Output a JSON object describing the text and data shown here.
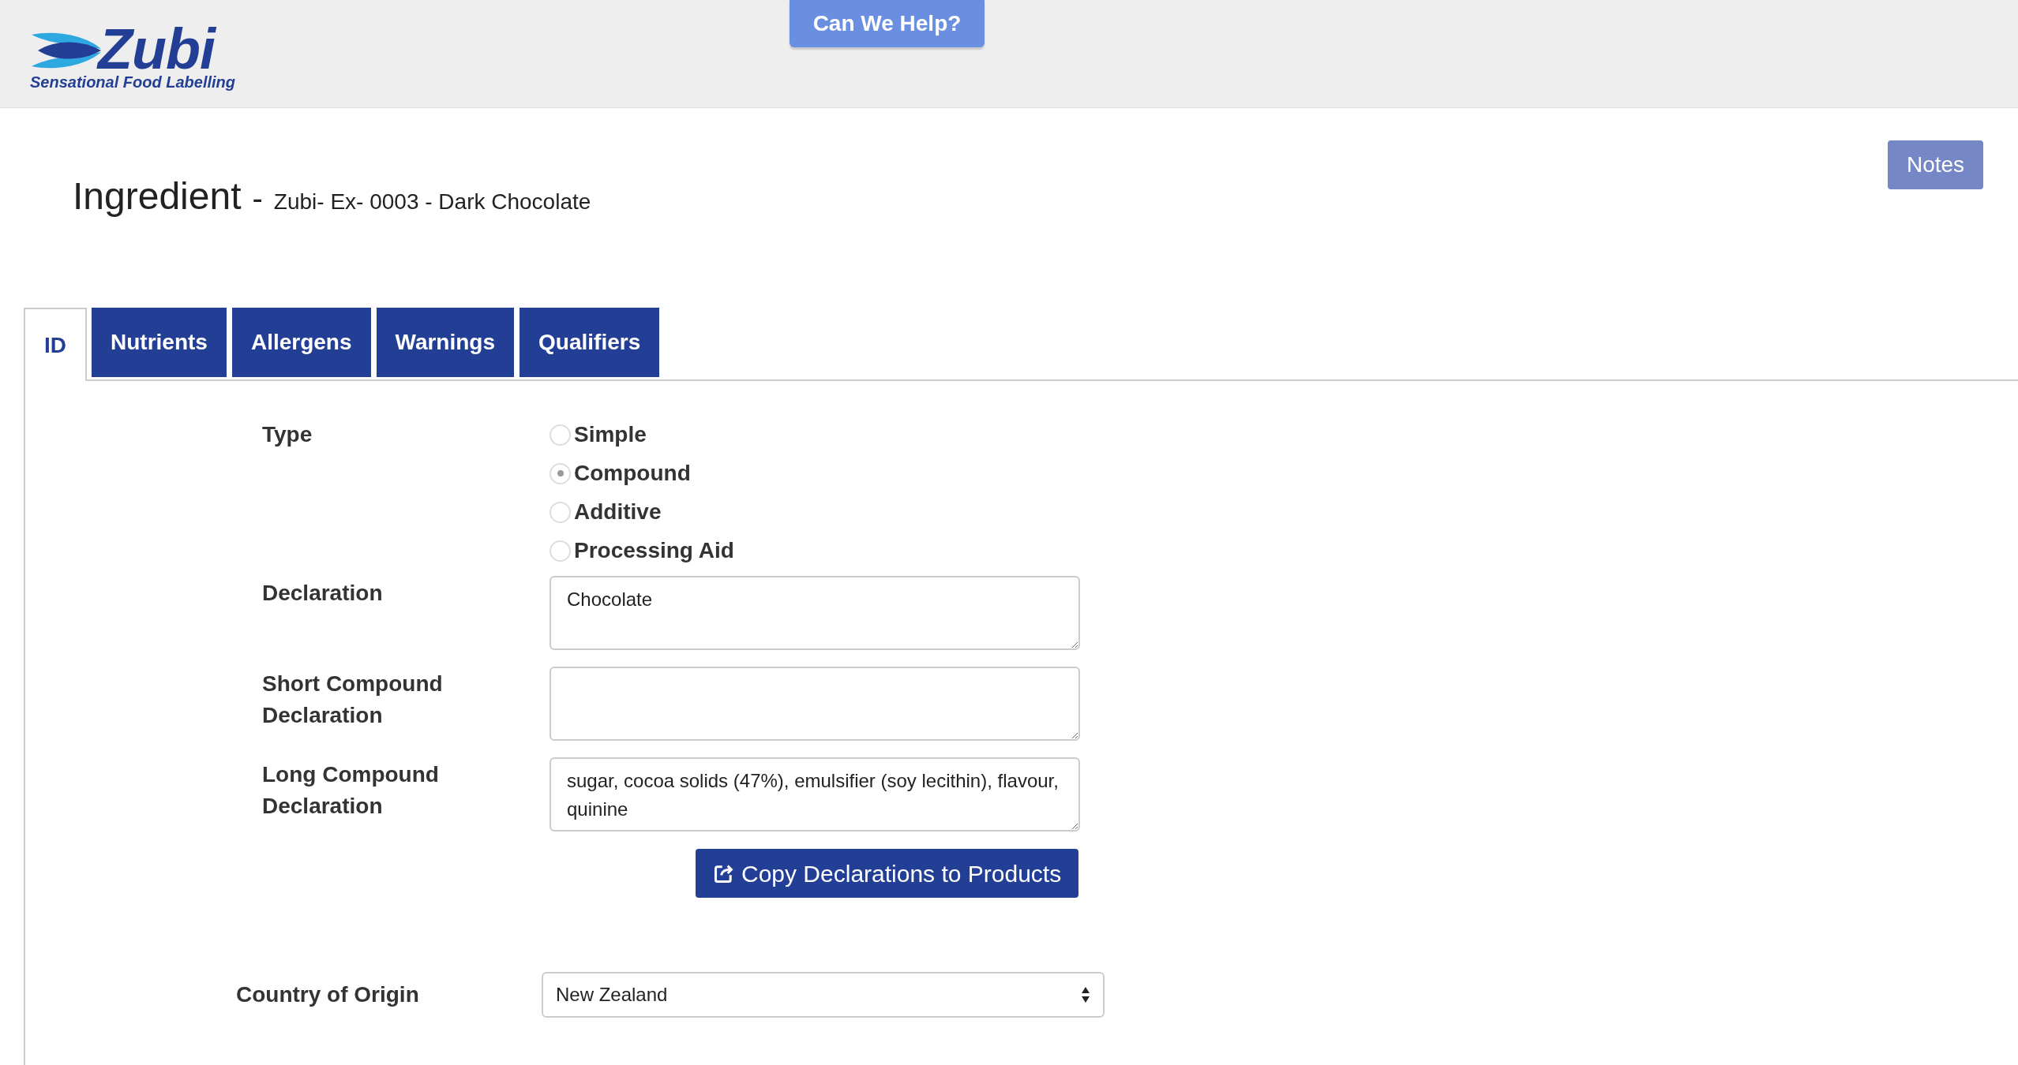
{
  "header": {
    "logo": {
      "name": "Zubi",
      "tagline": "Sensational Food Labelling"
    },
    "help_button": "Can We Help?"
  },
  "page": {
    "title": "Ingredient",
    "separator": "-",
    "subtitle": "Zubi- Ex- 0003 - Dark Chocolate",
    "notes_button": "Notes"
  },
  "tabs": [
    {
      "label": "ID",
      "selected": true
    },
    {
      "label": "Nutrients",
      "selected": false
    },
    {
      "label": "Allergens",
      "selected": false
    },
    {
      "label": "Warnings",
      "selected": false
    },
    {
      "label": "Qualifiers",
      "selected": false
    }
  ],
  "form": {
    "type": {
      "label": "Type",
      "options": [
        {
          "label": "Simple",
          "selected": false
        },
        {
          "label": "Compound",
          "selected": true
        },
        {
          "label": "Additive",
          "selected": false
        },
        {
          "label": "Processing Aid",
          "selected": false
        }
      ]
    },
    "fields": [
      {
        "label": "Declaration",
        "value": "Chocolate"
      },
      {
        "label": "Short Compound Declaration"
      },
      {
        "label": "Long Compound Declaration",
        "value": "sugar, cocoa solids (47%), emulsifier (soy lecithin), flavour, quinine"
      }
    ],
    "copy_button": "Copy Declarations to Products",
    "country": {
      "label": "Country of Origin",
      "value": "New Zealand"
    }
  }
}
